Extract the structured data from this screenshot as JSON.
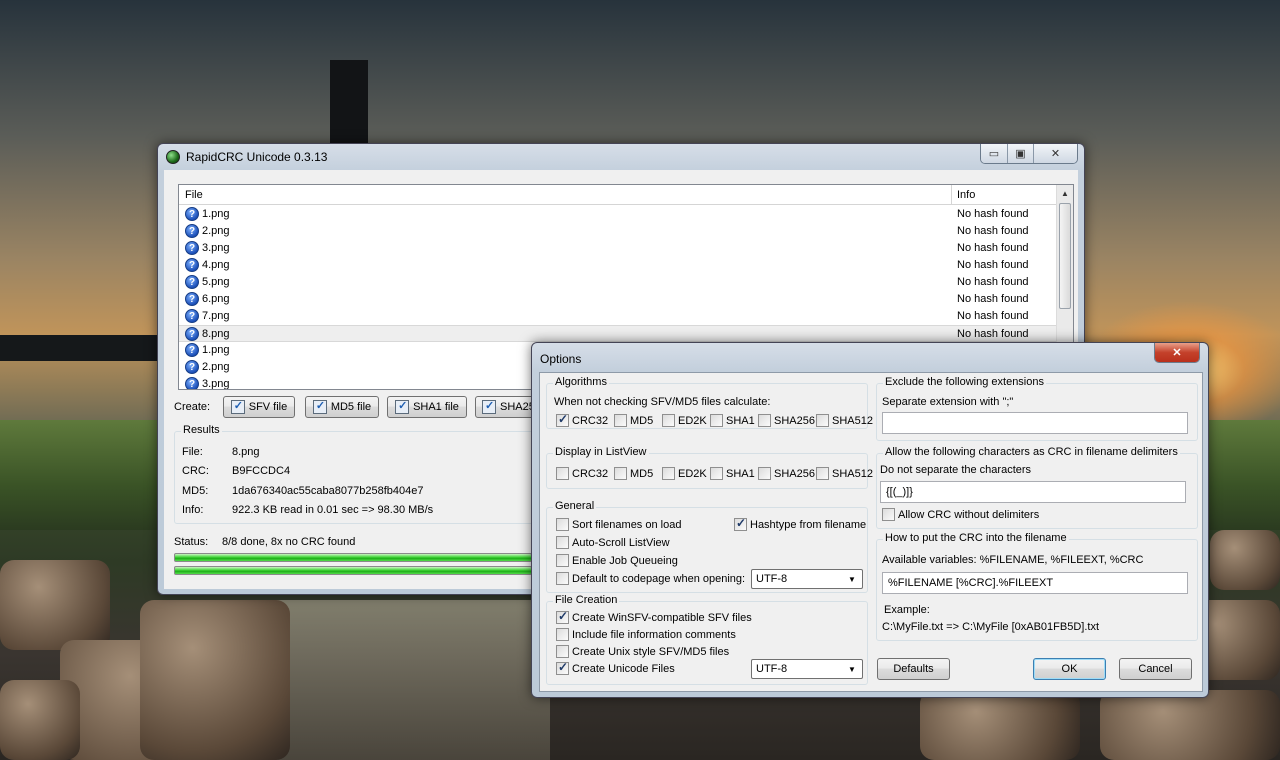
{
  "main_window": {
    "title": "RapidCRC Unicode 0.3.13",
    "controls": {
      "minimize": "▭",
      "maximize": "▣",
      "close": "✕"
    },
    "columns": {
      "file": "File",
      "info": "Info"
    },
    "rows": [
      {
        "name": "1.png",
        "info": "No hash found",
        "selected": false
      },
      {
        "name": "2.png",
        "info": "No hash found",
        "selected": false
      },
      {
        "name": "3.png",
        "info": "No hash found",
        "selected": false
      },
      {
        "name": "4.png",
        "info": "No hash found",
        "selected": false
      },
      {
        "name": "5.png",
        "info": "No hash found",
        "selected": false
      },
      {
        "name": "6.png",
        "info": "No hash found",
        "selected": false
      },
      {
        "name": "7.png",
        "info": "No hash found",
        "selected": false
      },
      {
        "name": "8.png",
        "info": "No hash found",
        "selected": true
      },
      {
        "name": "1.png",
        "info": "",
        "selected": false
      },
      {
        "name": "2.png",
        "info": "",
        "selected": false
      },
      {
        "name": "3.png",
        "info": "",
        "selected": false
      }
    ],
    "create": {
      "label": "Create:",
      "buttons": [
        "SFV file",
        "MD5 file",
        "SHA1 file",
        "SHA25"
      ]
    },
    "results": {
      "title": "Results",
      "file_label": "File:",
      "file_value": "8.png",
      "crc_label": "CRC:",
      "crc_value": "B9FCCDC4",
      "md5_label": "MD5:",
      "md5_value": "1da676340ac55caba8077b258fb404e7",
      "info_label": "Info:",
      "info_value": "922.3 KB read in 0.01 sec => 98.30 MB/s"
    },
    "status": {
      "label": "Status:",
      "value": "8/8 done, 8x no CRC found",
      "progress": 1.0,
      "progress_total": 1.0
    }
  },
  "options": {
    "title": "Options",
    "algorithms": {
      "title": "Algorithms",
      "subtitle": "When not checking SFV/MD5 files calculate:",
      "items": [
        {
          "label": "CRC32",
          "checked": true
        },
        {
          "label": "MD5",
          "checked": false
        },
        {
          "label": "ED2K",
          "checked": false
        },
        {
          "label": "SHA1",
          "checked": false
        },
        {
          "label": "SHA256",
          "checked": false
        },
        {
          "label": "SHA512",
          "checked": false
        }
      ]
    },
    "display": {
      "title": "Display in ListView",
      "items": [
        {
          "label": "CRC32",
          "checked": false
        },
        {
          "label": "MD5",
          "checked": false
        },
        {
          "label": "ED2K",
          "checked": false
        },
        {
          "label": "SHA1",
          "checked": false
        },
        {
          "label": "SHA256",
          "checked": false
        },
        {
          "label": "SHA512",
          "checked": false
        }
      ]
    },
    "general": {
      "title": "General",
      "sort": {
        "label": "Sort filenames on load",
        "checked": false
      },
      "hashtype": {
        "label": "Hashtype from filename",
        "checked": true
      },
      "autoscroll": {
        "label": "Auto-Scroll ListView",
        "checked": false
      },
      "queue": {
        "label": "Enable Job Queueing",
        "checked": false
      },
      "codepage": {
        "label": "Default to codepage when opening:",
        "checked": false,
        "value": "UTF-8"
      }
    },
    "file_creation": {
      "title": "File Creation",
      "winsfv": {
        "label": "Create WinSFV-compatible SFV files",
        "checked": true
      },
      "comments": {
        "label": "Include file information comments",
        "checked": false
      },
      "unix": {
        "label": "Create Unix style SFV/MD5 files",
        "checked": false
      },
      "unicode": {
        "label": "Create Unicode Files",
        "checked": true,
        "value": "UTF-8"
      }
    },
    "exclude": {
      "title": "Exclude the following extensions",
      "subtitle": "Separate extension with \";\"",
      "value": ""
    },
    "delimiters": {
      "title": "Allow the following characters as CRC in filename delimiters",
      "subtitle": "Do not separate the characters",
      "value": "{[(_)]}",
      "allow_without": {
        "label": "Allow CRC without delimiters",
        "checked": false
      }
    },
    "put_crc": {
      "title": "How to put the CRC into the filename",
      "subtitle": "Available variables: %FILENAME, %FILEEXT, %CRC",
      "value": "%FILENAME [%CRC].%FILEEXT",
      "example_label": "Example:",
      "example_value": "C:\\MyFile.txt => C:\\MyFile [0xAB01FB5D].txt"
    },
    "buttons": {
      "defaults": "Defaults",
      "ok": "OK",
      "cancel": "Cancel"
    }
  }
}
